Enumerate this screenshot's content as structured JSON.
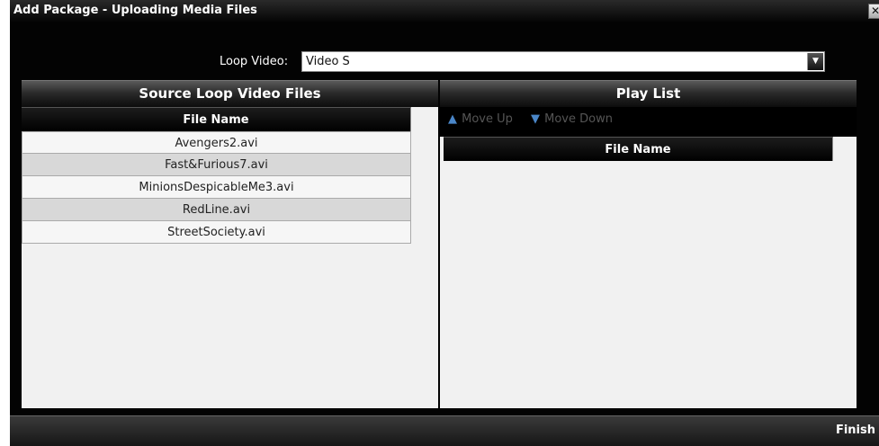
{
  "dialog": {
    "title": "Add Package - Uploading Media Files",
    "close_glyph": "✕"
  },
  "loop_video": {
    "label": "Loop Video:",
    "value": "Video S",
    "arrow": "▼"
  },
  "source_panel": {
    "title": "Source Loop Video Files",
    "column_header": "File Name",
    "files": [
      "Avengers2.avi",
      "Fast&Furious7.avi",
      "MinionsDespicableMe3.avi",
      "RedLine.avi",
      "StreetSociety.avi"
    ]
  },
  "playlist_panel": {
    "title": "Play List",
    "move_up": "Move Up",
    "move_down": "Move Down",
    "move_up_icon": "arrow-up-icon",
    "move_down_icon": "arrow-down-icon",
    "column_header": "File Name"
  },
  "footer": {
    "finish_label": "Finish"
  },
  "colors": {
    "dialog_bg": "#030303",
    "row_even": "#f6f6f6",
    "row_odd": "#d8d8d8",
    "arrow_icon": "#4a86c8",
    "disabled_text": "#555555"
  }
}
